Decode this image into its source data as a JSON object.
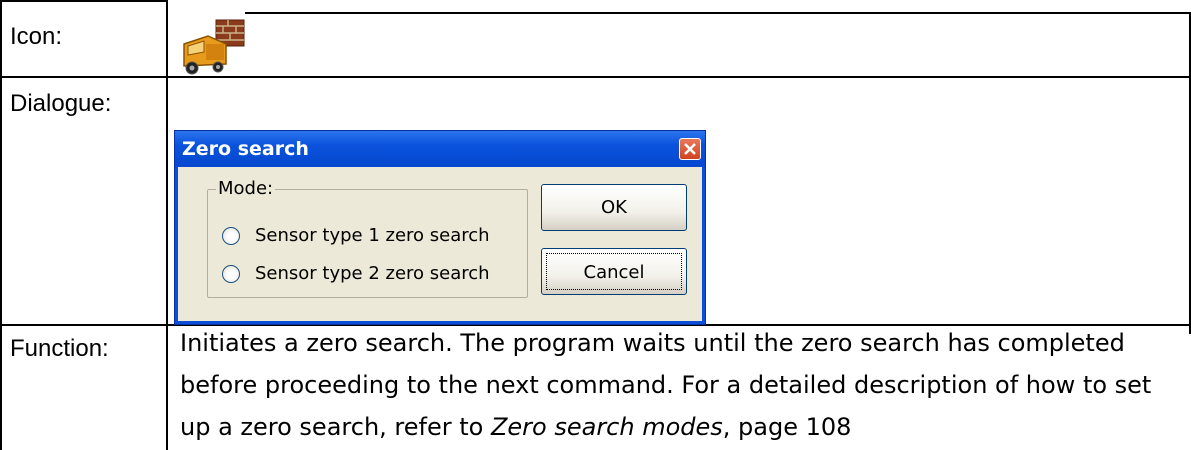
{
  "table": {
    "rows": [
      {
        "label": "Icon:"
      },
      {
        "label": "Dialogue:"
      },
      {
        "label": "Function:"
      }
    ]
  },
  "icon": {
    "name": "truck-with-bricks-icon"
  },
  "dialog": {
    "title": "Zero search",
    "group_label": "Mode:",
    "options": [
      "Sensor type 1 zero search",
      "Sensor type 2 zero search"
    ],
    "ok_label": "OK",
    "cancel_label": "Cancel"
  },
  "function": {
    "text_before": "Initiates a zero search. The program waits until the zero search has completed before proceeding to the next command. For a detailed description of how to set up a zero search, refer to ",
    "link_text": "Zero search modes",
    "text_after": ", page 108"
  }
}
